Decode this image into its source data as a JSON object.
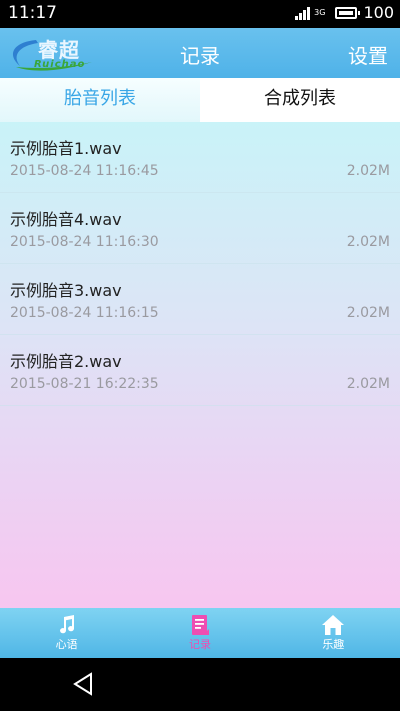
{
  "status_bar": {
    "time": "11:17",
    "network": "3G",
    "battery": "100"
  },
  "header": {
    "logo_text_cn": "睿超",
    "logo_text_en": "Ruichao",
    "title": "记录",
    "settings_label": "设置"
  },
  "tabs": [
    {
      "label": "胎音列表",
      "active": true
    },
    {
      "label": "合成列表",
      "active": false
    }
  ],
  "files": [
    {
      "name": "示例胎音1.wav",
      "date": "2015-08-24 11:16:45",
      "size": "2.02M"
    },
    {
      "name": "示例胎音4.wav",
      "date": "2015-08-24 11:16:30",
      "size": "2.02M"
    },
    {
      "name": "示例胎音3.wav",
      "date": "2015-08-24 11:16:15",
      "size": "2.02M"
    },
    {
      "name": "示例胎音2.wav",
      "date": "2015-08-21 16:22:35",
      "size": "2.02M"
    }
  ],
  "bottom_nav": [
    {
      "label": "心语",
      "icon": "music-note-icon",
      "active": false
    },
    {
      "label": "记录",
      "icon": "record-list-icon",
      "active": true
    },
    {
      "label": "乐趣",
      "icon": "home-icon",
      "active": false
    }
  ],
  "colors": {
    "header": "#4fb2e8",
    "active_tab": "#39a6e6",
    "active_nav": "#ee4db2"
  }
}
